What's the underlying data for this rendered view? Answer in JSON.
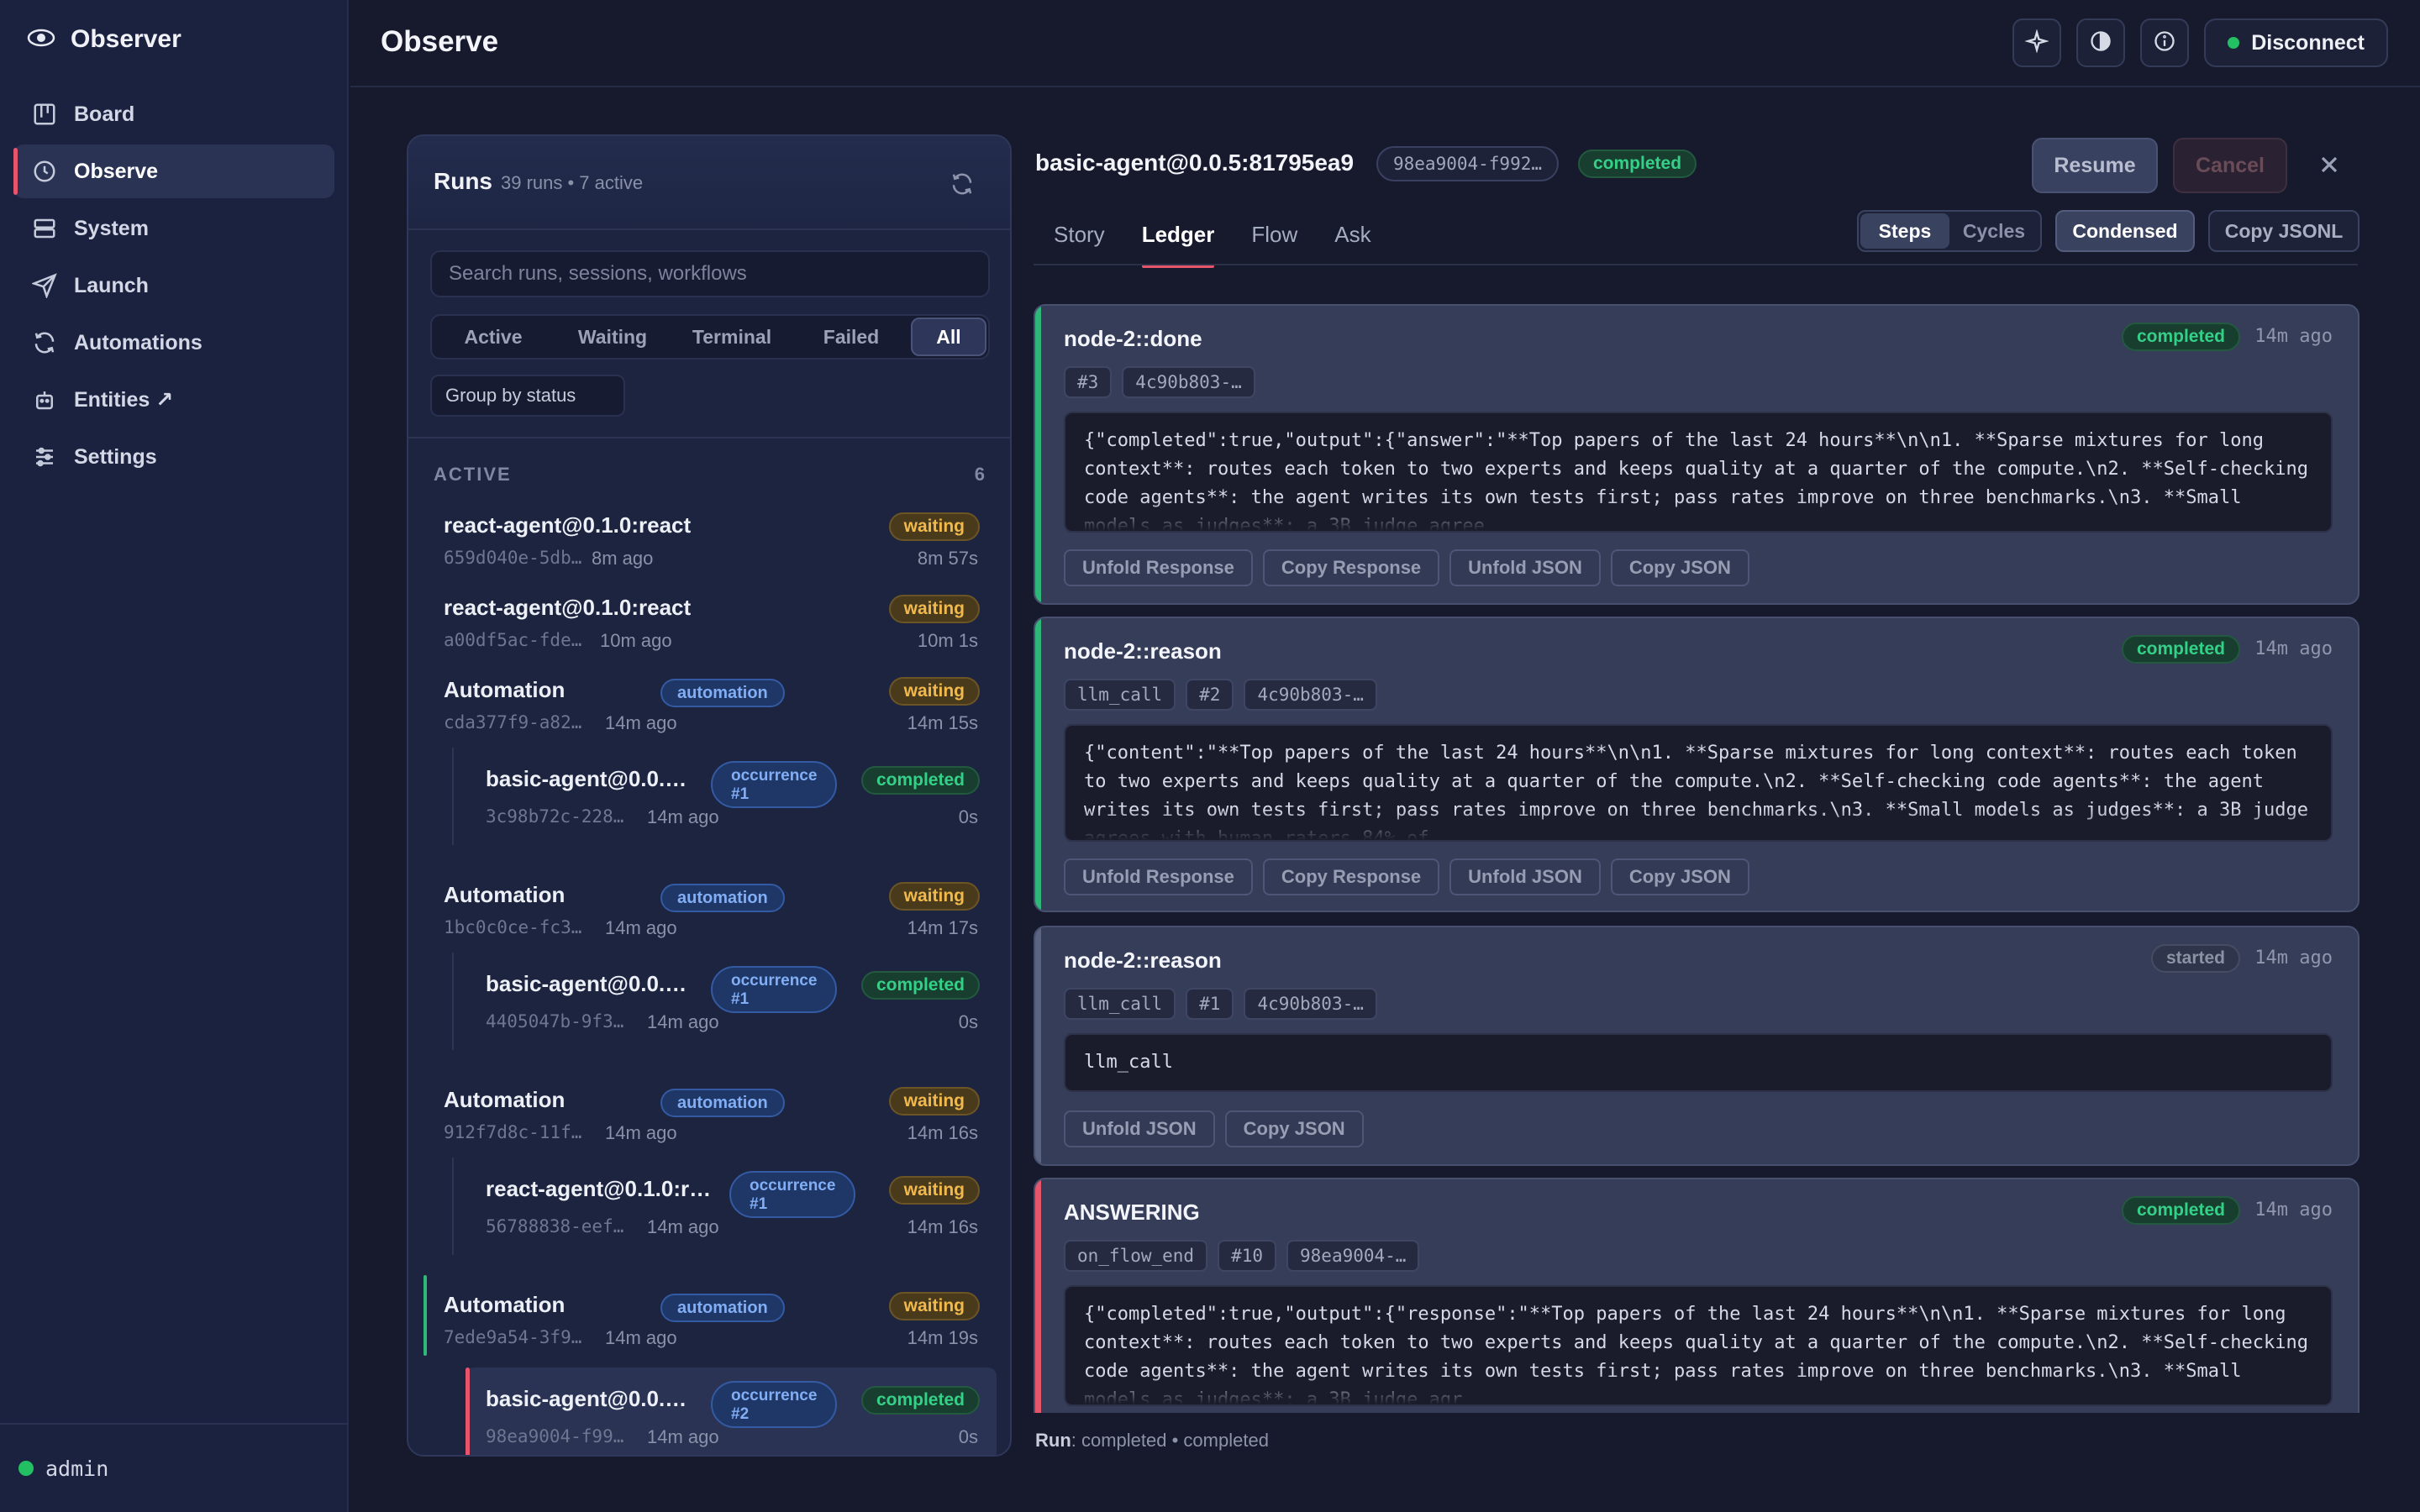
{
  "app": {
    "brand": "Observer",
    "page_title": "Observe"
  },
  "sidebar": {
    "items": [
      {
        "label": "Board",
        "icon": "board-icon"
      },
      {
        "label": "Observe",
        "icon": "clock-icon",
        "active": true
      },
      {
        "label": "System",
        "icon": "server-icon"
      },
      {
        "label": "Launch",
        "icon": "send-icon"
      },
      {
        "label": "Automations",
        "icon": "refresh-icon"
      },
      {
        "label": "Entities ↗",
        "icon": "robot-icon"
      },
      {
        "label": "Settings",
        "icon": "sliders-icon"
      }
    ],
    "user": "admin"
  },
  "topbar": {
    "disconnect": "Disconnect"
  },
  "runs": {
    "title": "Runs",
    "meta": "39 runs • 7 active",
    "search_placeholder": "Search runs, sessions, workflows",
    "filters": [
      "Active",
      "Waiting",
      "Terminal",
      "Failed",
      "All"
    ],
    "active_filter": "All",
    "group_by": "Group by status",
    "section": {
      "label": "ACTIVE",
      "count": "6"
    },
    "rows": [
      {
        "name": "react-agent@0.1.0:react",
        "id": "659d040e-5db…",
        "ago": "8m ago",
        "status": "waiting",
        "elapsed": "8m 57s"
      },
      {
        "name": "react-agent@0.1.0:react",
        "id": "a00df5ac-fde…",
        "ago": "10m ago",
        "status": "waiting",
        "elapsed": "10m 1s"
      },
      {
        "name": "Automation",
        "tag": "automation",
        "id": "cda377f9-a82…",
        "ago": "14m ago",
        "status": "waiting",
        "elapsed": "14m 15s"
      },
      {
        "name": "basic-agent@0.0.…",
        "tag": "occurrence #1",
        "id": "3c98b72c-228…",
        "ago": "14m ago",
        "status": "completed",
        "elapsed": "0s",
        "child": true
      },
      {
        "name": "Automation",
        "tag": "automation",
        "id": "1bc0c0ce-fc3…",
        "ago": "14m ago",
        "status": "waiting",
        "elapsed": "14m 17s"
      },
      {
        "name": "basic-agent@0.0.…",
        "tag": "occurrence #1",
        "id": "4405047b-9f3…",
        "ago": "14m ago",
        "status": "completed",
        "elapsed": "0s",
        "child": true
      },
      {
        "name": "Automation",
        "tag": "automation",
        "id": "912f7d8c-11f…",
        "ago": "14m ago",
        "status": "waiting",
        "elapsed": "14m 16s"
      },
      {
        "name": "react-agent@0.1.0:r…",
        "tag": "occurrence #1",
        "id": "56788838-eef…",
        "ago": "14m ago",
        "status": "waiting",
        "elapsed": "14m 16s",
        "child": true
      },
      {
        "name": "Automation",
        "tag": "automation",
        "id": "7ede9a54-3f9…",
        "ago": "14m ago",
        "status": "waiting",
        "elapsed": "14m 19s"
      },
      {
        "name": "basic-agent@0.0.…",
        "tag": "occurrence #2",
        "id": "98ea9004-f99…",
        "ago": "14m ago",
        "status": "completed",
        "elapsed": "0s",
        "child": true,
        "selected": true
      }
    ]
  },
  "detail": {
    "title": "basic-agent@0.0.5:81795ea9",
    "id_chip": "98ea9004-f992…",
    "status": "completed",
    "resume": "Resume",
    "cancel": "Cancel",
    "tabs": [
      "Story",
      "Ledger",
      "Flow",
      "Ask"
    ],
    "active_tab": "Ledger",
    "view_toggle": [
      "Steps",
      "Cycles"
    ],
    "active_view": "Steps",
    "condensed": "Condensed",
    "copy_jsonl": "Copy JSONL",
    "cards": [
      {
        "title": "node-2::done",
        "status": "completed",
        "time": "14m ago",
        "chips": [
          "#3",
          "4c90b803-…"
        ],
        "code": "{\"completed\":true,\"output\":{\"answer\":\"**Top papers of the last 24 hours**\\n\\n1. **Sparse mixtures for long context**: routes each token to two experts and keeps quality at a quarter of the compute.\\n2. **Self-checking code agents**: the agent writes its own tests first; pass rates improve on three benchmarks.\\n3. **Small models as judges**: a 3B judge agree",
        "actions": [
          "Unfold Response",
          "Copy Response",
          "Unfold JSON",
          "Copy JSON"
        ]
      },
      {
        "title": "node-2::reason",
        "status": "completed",
        "time": "14m ago",
        "chips": [
          "llm_call",
          "#2",
          "4c90b803-…"
        ],
        "code": "{\"content\":\"**Top papers of the last 24 hours**\\n\\n1. **Sparse mixtures for long context**: routes each token to two experts and keeps quality at a quarter of the compute.\\n2. **Self-checking code agents**: the agent writes its own tests first; pass rates improve on three benchmarks.\\n3. **Small models as judges**: a 3B judge agrees with human raters 84% of",
        "actions": [
          "Unfold Response",
          "Copy Response",
          "Unfold JSON",
          "Copy JSON"
        ]
      },
      {
        "title": "node-2::reason",
        "status": "started",
        "time": "14m ago",
        "chips": [
          "llm_call",
          "#1",
          "4c90b803-…"
        ],
        "code": "llm_call",
        "actions": [
          "Unfold JSON",
          "Copy JSON"
        ]
      },
      {
        "title": "ANSWERING",
        "status": "completed",
        "time": "14m ago",
        "chips": [
          "on_flow_end",
          "#10",
          "98ea9004-…"
        ],
        "code": "{\"completed\":true,\"output\":{\"response\":\"**Top papers of the last 24 hours**\\n\\n1. **Sparse mixtures for long context**: routes each token to two experts and keeps quality at a quarter of the compute.\\n2. **Self-checking code agents**: the agent writes its own tests first; pass rates improve on three benchmarks.\\n3. **Small models as judges**: a 3B judge agr",
        "actions": []
      }
    ],
    "footer_label": "Run",
    "footer_text": ": completed • completed"
  },
  "colors": {
    "accent": "#e7556c",
    "completed": "#35d087",
    "waiting": "#f1b94c",
    "tag": "#82aef5"
  }
}
